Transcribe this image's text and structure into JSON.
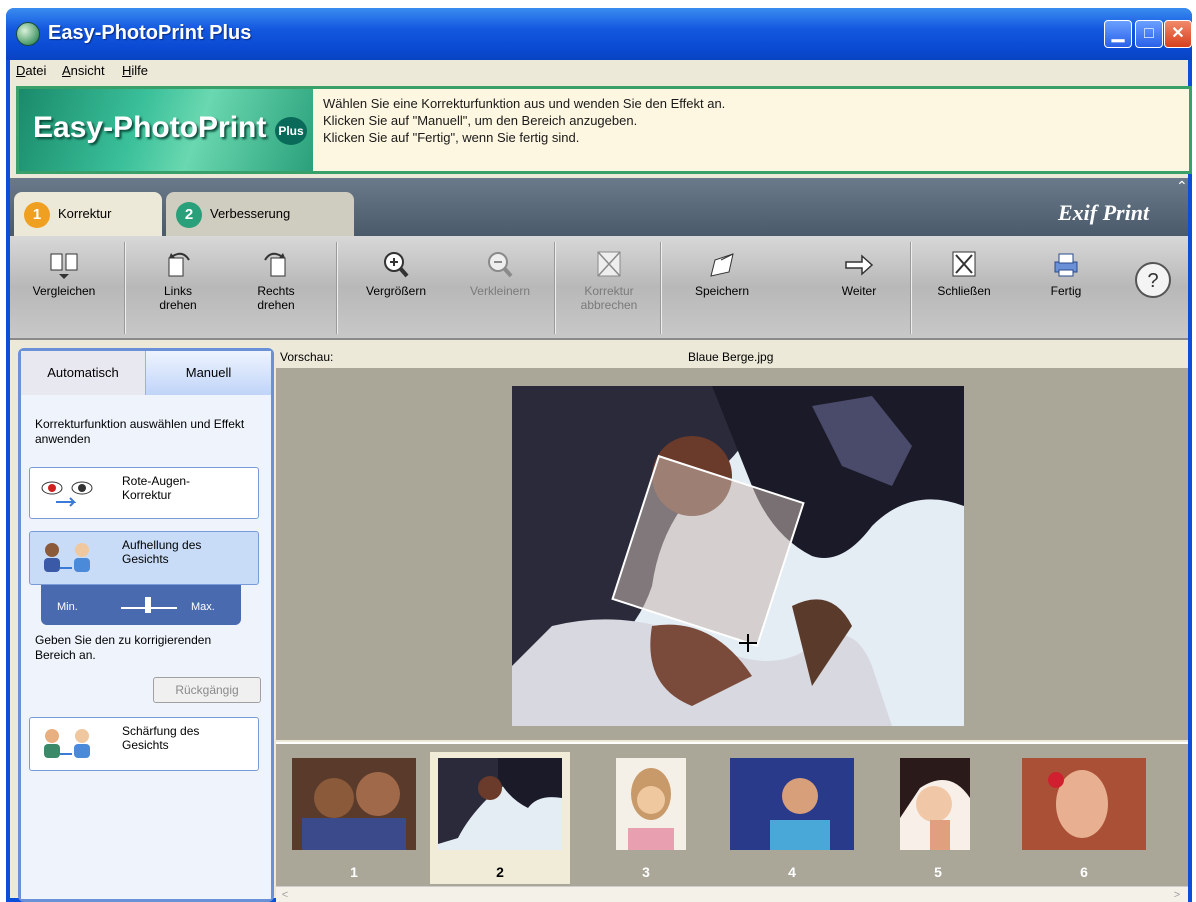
{
  "window": {
    "title": "Easy-PhotoPrint Plus",
    "minimize": "▁",
    "maximize": "□",
    "close": "✕"
  },
  "menu": {
    "items": [
      "Datei",
      "Ansicht",
      "Hilfe"
    ]
  },
  "banner": {
    "logo_text": "Easy-PhotoPrint",
    "logo_plus": "Plus",
    "messages": [
      "Wählen Sie eine Korrekturfunktion aus und wenden Sie den Effekt an.",
      "Klicken Sie auf \"Manuell\", um den Bereich anzugeben.",
      "Klicken Sie auf \"Fertig\", wenn Sie fertig sind."
    ]
  },
  "tabs": [
    {
      "number": "1",
      "label": "Korrektur",
      "active": true
    },
    {
      "number": "2",
      "label": "Verbesserung",
      "active": false
    }
  ],
  "exif_logo": "Exif Print",
  "toolbar": {
    "buttons": [
      {
        "label": "Vergleichen",
        "icon": "compare-icon",
        "enabled": true
      },
      {
        "label": "Links drehen",
        "icon": "rotate-left-icon",
        "enabled": true
      },
      {
        "label": "Rechts drehen",
        "icon": "rotate-right-icon",
        "enabled": true
      },
      {
        "label": "Vergrößern",
        "icon": "zoom-in-icon",
        "enabled": true
      },
      {
        "label": "Verkleinern",
        "icon": "zoom-out-icon",
        "enabled": false
      },
      {
        "label": "Korrektur abbrechen",
        "icon": "cancel-correction-icon",
        "enabled": false
      },
      {
        "label": "Speichern",
        "icon": "save-icon",
        "enabled": true
      },
      {
        "label": "Weiter",
        "icon": "arrow-right-icon",
        "enabled": true
      },
      {
        "label": "Schließen",
        "icon": "close-icon",
        "enabled": true
      },
      {
        "label": "Fertig",
        "icon": "printer-icon",
        "enabled": true
      },
      {
        "label": "",
        "icon": "help-icon",
        "enabled": true
      }
    ]
  },
  "left_panel": {
    "tabs": [
      "Automatisch",
      "Manuell"
    ],
    "active_tab": "Manuell",
    "description": "Korrekturfunktion auswählen und Effekt anwenden",
    "functions": [
      {
        "label": "Rote-Augen-Korrektur",
        "icon": "red-eye-icon"
      },
      {
        "label": "Aufhellung des Gesichts",
        "icon": "face-brightening-icon"
      },
      {
        "label": "Schärfung des Gesichts",
        "icon": "face-sharpening-icon"
      }
    ],
    "slider": {
      "min_label": "Min.",
      "max_label": "Max.",
      "level": 0.5
    },
    "hint": "Geben Sie den zu korrigierenden Bereich an.",
    "undo_label": "Rückgängig"
  },
  "preview": {
    "label": "Vorschau:",
    "filename": "Blaue Berge.jpg"
  },
  "filmstrip": {
    "thumbs": [
      "1",
      "2",
      "3",
      "4",
      "5",
      "6"
    ],
    "selected": "2"
  }
}
